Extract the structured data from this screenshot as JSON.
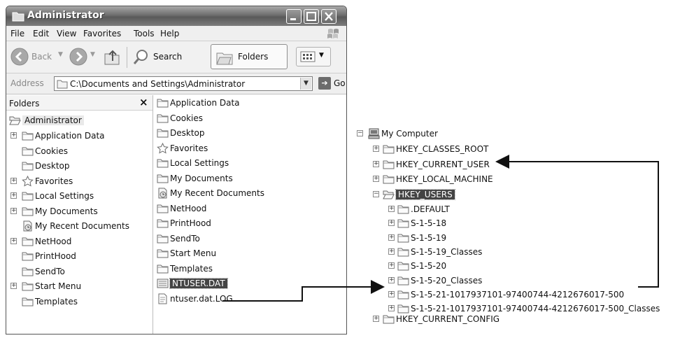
{
  "window": {
    "title": "Administrator",
    "menu": [
      "File",
      "Edit",
      "View",
      "Favorites",
      "Tools",
      "Help"
    ],
    "toolbar": {
      "back": "Back",
      "search": "Search",
      "folders": "Folders"
    },
    "address": {
      "label": "Address",
      "value": "C:\\Documents and Settings\\Administrator",
      "go": "Go"
    }
  },
  "folders_pane": {
    "header": "Folders",
    "close": "×",
    "root": "Administrator",
    "items": [
      {
        "label": "Application Data",
        "expander": "+",
        "icon": "folder-icon"
      },
      {
        "label": "Cookies",
        "expander": "",
        "icon": "folder-icon"
      },
      {
        "label": "Desktop",
        "expander": "",
        "icon": "folder-icon"
      },
      {
        "label": "Favorites",
        "expander": "+",
        "icon": "star-icon"
      },
      {
        "label": "Local Settings",
        "expander": "+",
        "icon": "folder-icon"
      },
      {
        "label": "My Documents",
        "expander": "+",
        "icon": "folder-icon"
      },
      {
        "label": "My Recent Documents",
        "expander": "",
        "icon": "recent-docs-icon"
      },
      {
        "label": "NetHood",
        "expander": "+",
        "icon": "folder-icon"
      },
      {
        "label": "PrintHood",
        "expander": "",
        "icon": "folder-icon"
      },
      {
        "label": "SendTo",
        "expander": "",
        "icon": "folder-icon"
      },
      {
        "label": "Start Menu",
        "expander": "+",
        "icon": "folder-icon"
      },
      {
        "label": "Templates",
        "expander": "",
        "icon": "folder-icon"
      }
    ]
  },
  "files_pane": {
    "items": [
      {
        "label": "Application Data",
        "icon": "folder-icon"
      },
      {
        "label": "Cookies",
        "icon": "folder-icon"
      },
      {
        "label": "Desktop",
        "icon": "folder-icon"
      },
      {
        "label": "Favorites",
        "icon": "star-icon"
      },
      {
        "label": "Local Settings",
        "icon": "folder-icon"
      },
      {
        "label": "My Documents",
        "icon": "folder-icon"
      },
      {
        "label": "My Recent Documents",
        "icon": "recent-docs-icon"
      },
      {
        "label": "NetHood",
        "icon": "folder-icon"
      },
      {
        "label": "PrintHood",
        "icon": "folder-icon"
      },
      {
        "label": "SendTo",
        "icon": "folder-icon"
      },
      {
        "label": "Start Menu",
        "icon": "folder-icon"
      },
      {
        "label": "Templates",
        "icon": "folder-icon"
      },
      {
        "label": "NTUSER.DAT",
        "icon": "data-file-icon",
        "selected": true
      },
      {
        "label": "ntuser.dat.LOG",
        "icon": "text-file-icon"
      }
    ]
  },
  "registry": {
    "root": "My Computer",
    "hives": [
      {
        "label": "HKEY_CLASSES_ROOT",
        "expander": "+"
      },
      {
        "label": "HKEY_CURRENT_USER",
        "expander": "+"
      },
      {
        "label": "HKEY_LOCAL_MACHINE",
        "expander": "+"
      },
      {
        "label": "HKEY_USERS",
        "expander": "-",
        "selected": true
      }
    ],
    "user_keys": [
      ".DEFAULT",
      "S-1-5-18",
      "S-1-5-19",
      "S-1-5-19_Classes",
      "S-1-5-20",
      "S-1-5-20_Classes",
      "S-1-5-21-1017937101-97400744-4212676017-500",
      "S-1-5-21-1017937101-97400744-4212676017-500_Classes"
    ],
    "last_hive": {
      "label": "HKEY_CURRENT_CONFIG",
      "expander": "+"
    }
  }
}
